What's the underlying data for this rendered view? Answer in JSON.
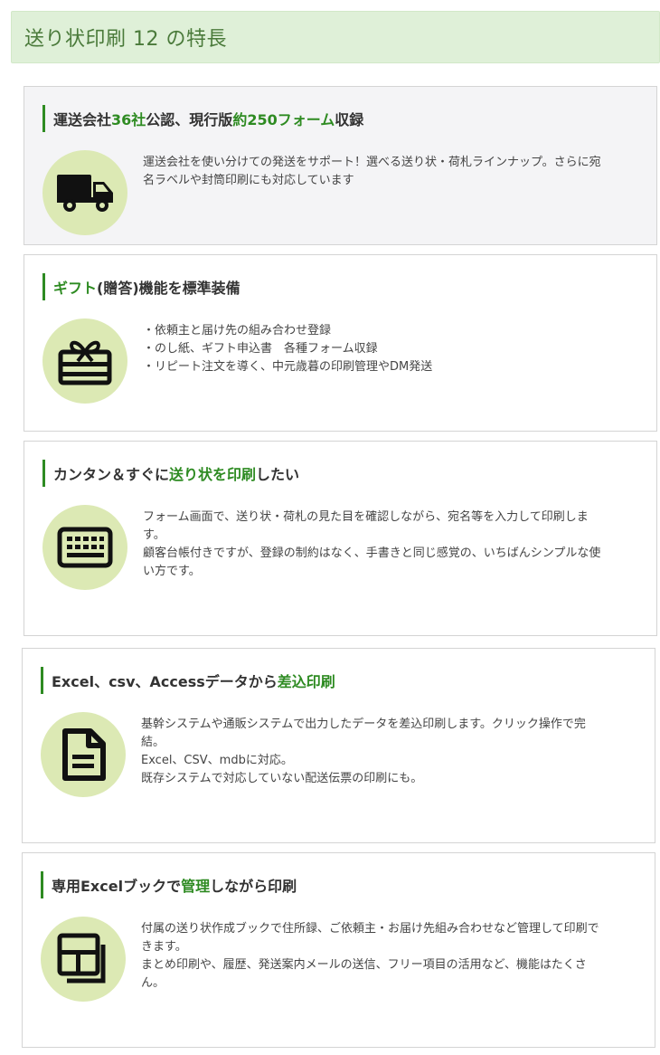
{
  "header": {
    "title": "送り状印刷 12 の特長"
  },
  "features": [
    {
      "title_parts": [
        "運送会社",
        "36社",
        "公認、現行版",
        "約250フォーム",
        "収録"
      ],
      "icon": "truck-icon",
      "lines": [
        "運送会社を使い分けての発送をサポート！選べる送り状・荷札ラインナップ。さらに宛",
        "名ラベルや封筒印刷にも対応しています"
      ]
    },
    {
      "title_parts": [
        "",
        "ギフト",
        "(贈答)機能を標準装備"
      ],
      "icon": "gift-card-icon",
      "lines": [
        "・依頼主と届け先の組み合わせ登録",
        "・のし紙、ギフト申込書　各種フォーム収録",
        "・リピート注文を導く、中元歳暮の印刷管理やDM発送"
      ]
    },
    {
      "title_parts": [
        "カンタン＆すぐに",
        "送り状を印刷",
        "したい"
      ],
      "icon": "keyboard-icon",
      "lines": [
        "フォーム画面で、送り状・荷札の見た目を確認しながら、宛名等を入力して印刷しま",
        "す。",
        "顧客台帳付きですが、登録の制約はなく、手書きと同じ感覚の、いちばんシンプルな使",
        "い方です。"
      ]
    },
    {
      "title_parts": [
        "Excel、csv、Accessデータから",
        "差込印刷",
        ""
      ],
      "icon": "document-icon",
      "lines": [
        "基幹システムや通販システムで出力したデータを差込印刷します。クリック操作で完",
        "結。",
        "Excel、CSV、mdbに対応。",
        "既存システムで対応していない配送伝票の印刷にも。"
      ]
    },
    {
      "title_parts": [
        "専用Excelブックで",
        "管理",
        "しながら印刷"
      ],
      "icon": "workbook-icon",
      "lines": [
        "付属の送り状作成ブックで住所録、ご依頼主・お届け先組み合わせなど管理して印刷で",
        "きます。",
        "まとめ印刷や、履歴、発送案内メールの送信、フリー項目の活用など、機能はたくさ",
        "ん。"
      ]
    }
  ]
}
